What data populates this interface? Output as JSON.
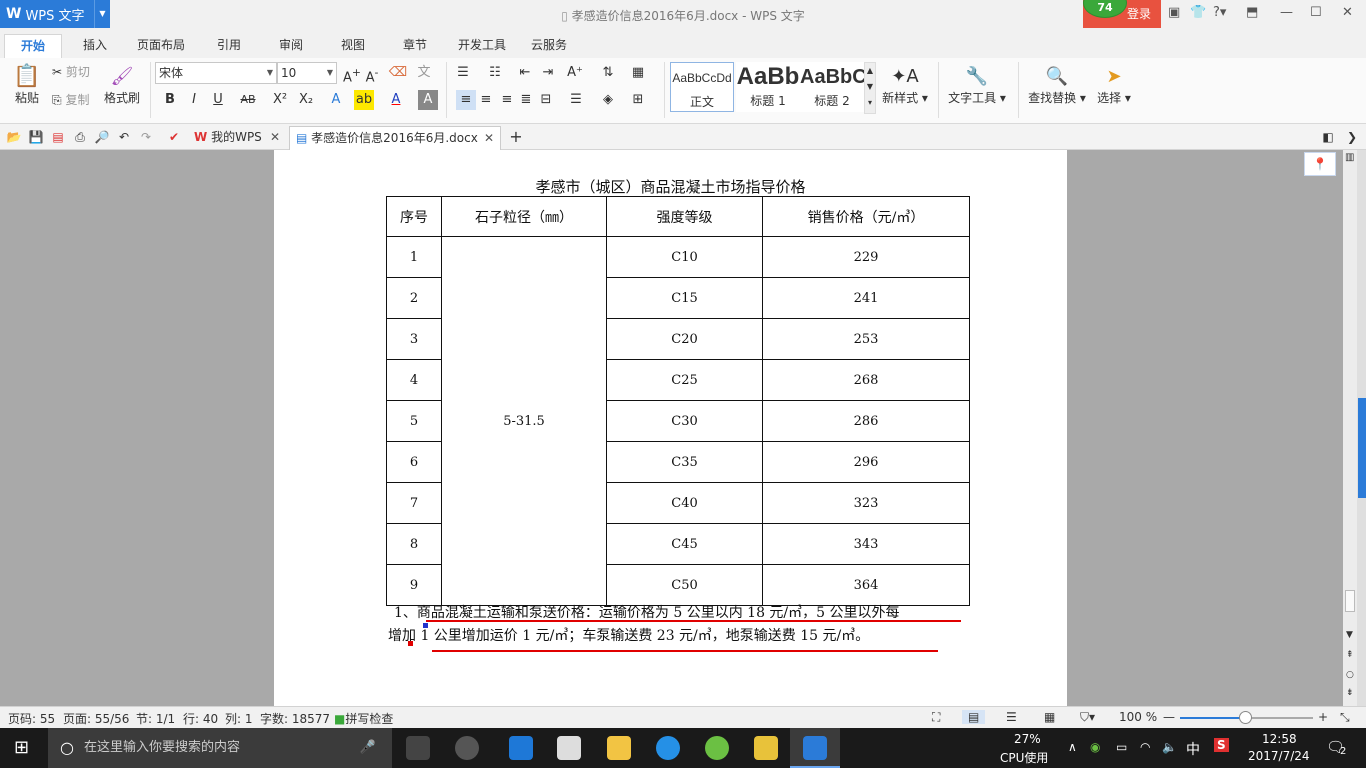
{
  "titlebar": {
    "app_name": "WPS 文字",
    "doc_title": "孝感造价信息2016年6月.docx - WPS 文字",
    "login_label": "登录",
    "badge_count": "74"
  },
  "tabs": [
    "开始",
    "插入",
    "页面布局",
    "引用",
    "审阅",
    "视图",
    "章节",
    "开发工具",
    "云服务"
  ],
  "ribbon": {
    "paste": "粘贴",
    "cut": "剪切",
    "copy": "复制",
    "format_painter": "格式刷",
    "font_name": "宋体",
    "font_size": "10",
    "styles": [
      {
        "sample": "AaBbCcDd",
        "name": "正文"
      },
      {
        "sample": "AaBb",
        "name": "标题 1"
      },
      {
        "sample": "AaBbC",
        "name": "标题 2"
      }
    ],
    "new_style": "新样式",
    "text_tools": "文字工具",
    "find_replace": "查找替换",
    "select": "选择"
  },
  "quickbar": {
    "tab_my_wps": "我的WPS",
    "tab_doc": "孝感造价信息2016年6月.docx"
  },
  "document": {
    "heading": "孝感市（城区）商品混凝土市场指导价格",
    "columns": [
      "序号",
      "石子粒径（㎜）",
      "强度等级",
      "销售价格（元/㎥）"
    ],
    "aggregate_size": "5-31.5",
    "rows": [
      {
        "no": "1",
        "grade": "C10",
        "price": "229"
      },
      {
        "no": "2",
        "grade": "C15",
        "price": "241"
      },
      {
        "no": "3",
        "grade": "C20",
        "price": "253"
      },
      {
        "no": "4",
        "grade": "C25",
        "price": "268"
      },
      {
        "no": "5",
        "grade": "C30",
        "price": "286"
      },
      {
        "no": "6",
        "grade": "C35",
        "price": "296"
      },
      {
        "no": "7",
        "grade": "C40",
        "price": "323"
      },
      {
        "no": "8",
        "grade": "C45",
        "price": "343"
      },
      {
        "no": "9",
        "grade": "C50",
        "price": "364"
      }
    ],
    "note_line1": "1、商品混凝土运输和泵送价格：运输价格为 5 公里以内 18 元/㎥，5 公里以外每",
    "note_line2": "增加 1 公里增加运价 1 元/㎥；车泵输送费 23 元/㎥，地泵输送费 15 元/㎥。"
  },
  "status": {
    "page_code": "页码: 55",
    "page": "页面: 55/56",
    "section": "节: 1/1",
    "row": "行: 40",
    "col": "列: 1",
    "word_count": "字数: 18577",
    "spell_check": "拼写检查",
    "zoom": "100 %"
  },
  "taskbar": {
    "search_placeholder": "在这里输入你要搜索的内容",
    "cpu_percent": "27%",
    "cpu_label": "CPU使用",
    "ime": "中",
    "time": "12:58",
    "date": "2017/7/24",
    "notification_count": "2"
  },
  "colors": {
    "accent": "#2b7bd8",
    "login": "#e8523f",
    "annotation": "#e00000"
  }
}
